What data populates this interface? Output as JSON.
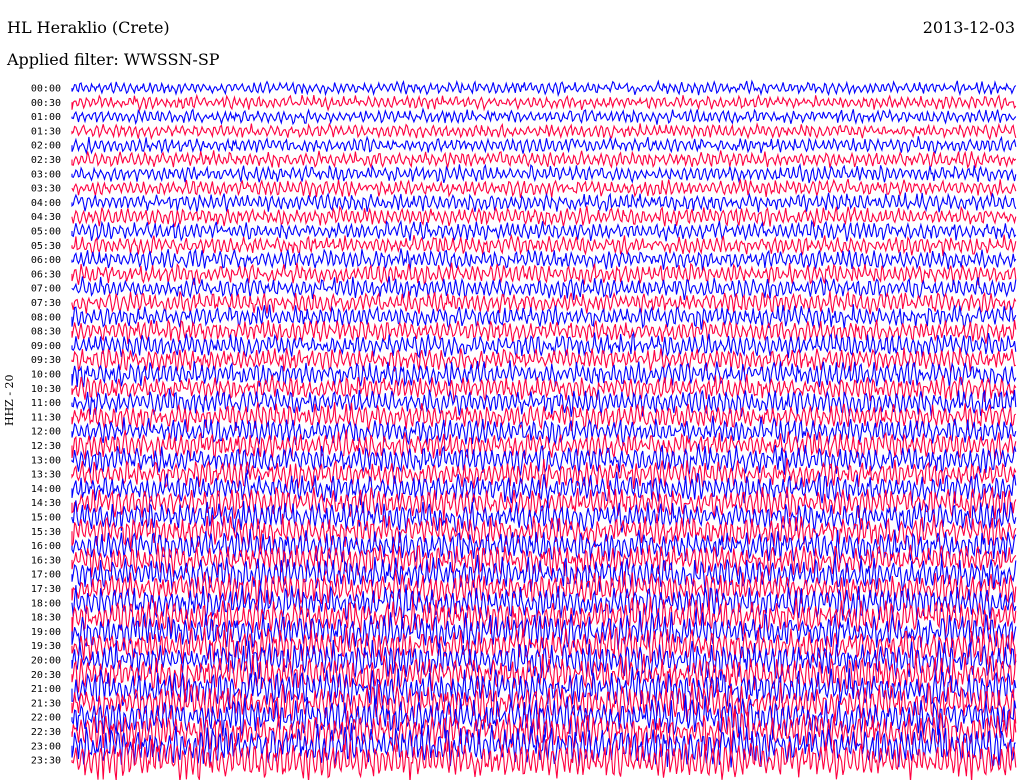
{
  "header": {
    "station": "HL Heraklio (Crete)",
    "filter": "Applied filter: WWSSN-SP",
    "date": "2013-12-03",
    "channel": "HHZ - 20"
  },
  "chart_data": {
    "type": "line",
    "title": "HL Heraklio (Crete)",
    "subtitle": "Applied filter: WWSSN-SP",
    "ylabel": "HHZ - 20",
    "row_labels": [
      "00:00",
      "00:30",
      "01:00",
      "01:30",
      "02:00",
      "02:30",
      "03:00",
      "03:30",
      "04:00",
      "04:30",
      "05:00",
      "05:30",
      "06:00",
      "06:30",
      "07:00",
      "07:30",
      "08:00",
      "08:30",
      "09:00",
      "09:30",
      "10:00",
      "10:30",
      "11:00",
      "11:30",
      "12:00",
      "12:30",
      "13:00",
      "13:30",
      "14:00",
      "14:30",
      "15:00",
      "15:30",
      "16:00",
      "16:30",
      "17:00",
      "17:30",
      "18:00",
      "18:30",
      "19:00",
      "19:30",
      "20:00",
      "20:30",
      "21:00",
      "21:30",
      "22:00",
      "22:30",
      "23:00",
      "23:30"
    ],
    "series_colors": [
      "#0000ff",
      "#ff0040"
    ],
    "grid": false
  }
}
